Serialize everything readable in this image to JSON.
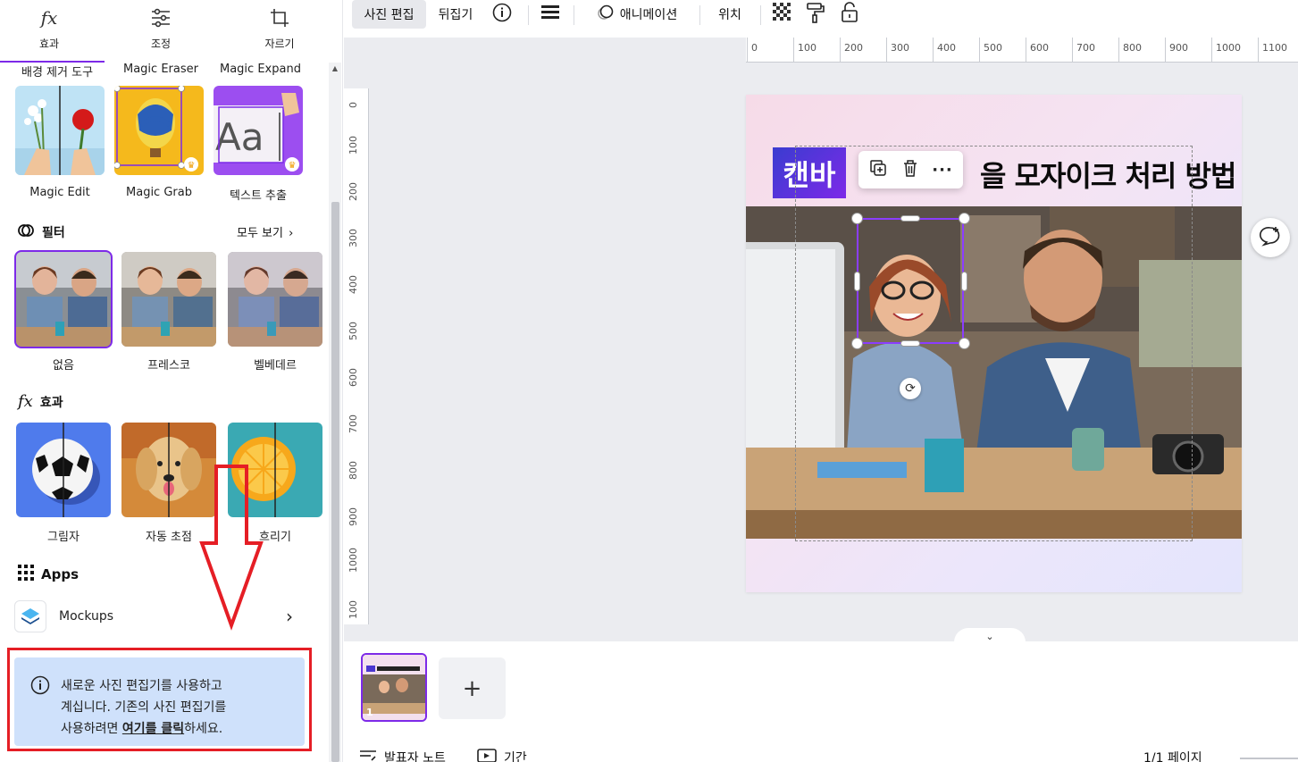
{
  "left_panel": {
    "tabs": [
      {
        "label": "효과",
        "icon": "fx-icon"
      },
      {
        "label": "조정",
        "icon": "sliders-icon"
      },
      {
        "label": "자르기",
        "icon": "crop-icon"
      }
    ],
    "tool_row_labels": [
      "배경 제거 도구",
      "Magic Eraser",
      "Magic Expand"
    ],
    "magic_tools": [
      {
        "label": "Magic Edit"
      },
      {
        "label": "Magic Grab"
      },
      {
        "label": "텍스트 추출"
      }
    ],
    "filters": {
      "title": "필터",
      "see_all": "모두 보기",
      "items": [
        {
          "label": "없음",
          "selected": true
        },
        {
          "label": "프레스코",
          "selected": false
        },
        {
          "label": "벨베데르",
          "selected": false
        }
      ]
    },
    "effects": {
      "title": "효과",
      "items": [
        {
          "label": "그림자"
        },
        {
          "label": "자동 초점"
        },
        {
          "label": "흐리기"
        }
      ]
    },
    "apps": {
      "title": "Apps",
      "items": [
        {
          "label": "Mockups"
        }
      ]
    },
    "info_notice": {
      "line1": "새로운 사진 편집기를 사용하고",
      "line2": "계십니다. 기존의 사진 편집기를",
      "line3_prefix": "사용하려면 ",
      "link": "여기를 클릭",
      "line3_suffix": "하세요."
    }
  },
  "toolbar": {
    "edit_photo": "사진 편집",
    "flip": "뒤집기",
    "animation": "애니메이션",
    "position": "위치"
  },
  "ruler": {
    "h_ticks": [
      "0",
      "100",
      "200",
      "300",
      "400",
      "500",
      "600",
      "700",
      "800",
      "900",
      "1000",
      "1100"
    ],
    "v_ticks": [
      "0",
      "100",
      "200",
      "300",
      "400",
      "500",
      "600",
      "700",
      "800",
      "900",
      "1000",
      "100"
    ]
  },
  "design": {
    "badge": "캔바",
    "title": "을 모자이크 처리 방법"
  },
  "pages": {
    "thumb_number": "1",
    "add_label": "+"
  },
  "footer": {
    "notes": "발표자 노트",
    "duration": "기간",
    "page_count": "1/1 페이지"
  },
  "colors": {
    "accent": "#7d2ae8",
    "annotation_red": "#e51e25",
    "info_bg": "#cfe1fb"
  }
}
